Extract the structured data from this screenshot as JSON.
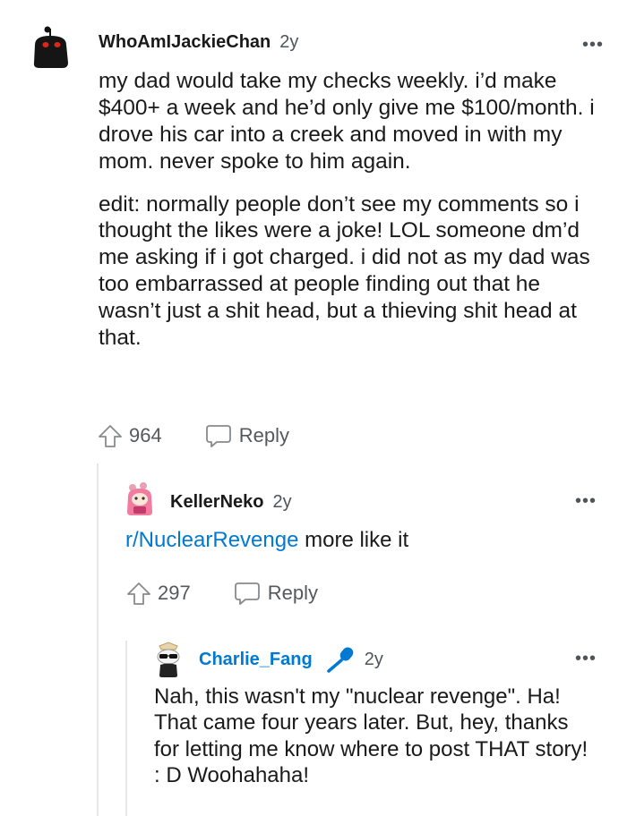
{
  "comments": [
    {
      "username": "WhoAmIJackieChan",
      "age": "2y",
      "paragraphs": [
        "my dad would take my checks weekly. i’d make $400+ a week and he’d only give me $100/month. i drove his car into a creek and moved in with my mom. never spoke to him again.",
        "edit: normally people don’t see my comments so i thought the likes were a joke! LOL someone dm’d me asking if i got charged. i did not as my dad was too embarrassed at people finding out that he wasn’t just a shit head, but a thieving shit head at that."
      ],
      "upvotes": "964",
      "reply_label": "Reply",
      "avatar_icon": "snoo-avatar-black-icon"
    },
    {
      "username": "KellerNeko",
      "age": "2y",
      "link_text": "r/NuclearRevenge",
      "text_after_link": " more like it",
      "upvotes": "297",
      "reply_label": "Reply",
      "avatar_icon": "snoo-avatar-pink-icon"
    },
    {
      "username": "Charlie_Fang",
      "age": "2y",
      "text": "Nah, this wasn't my \"nuclear revenge\". Ha! That came four years later. But, hey, thanks for letting me know where to post THAT story! : D Woohahaha!",
      "avatar_icon": "snoo-avatar-sunglasses-icon",
      "badge_icon": "microphone-icon"
    }
  ],
  "more_label": "•••",
  "colors": {
    "link": "#0079d3",
    "text": "#1a1a1b",
    "meta": "#4f5458",
    "thread_line": "#e5e7ea"
  }
}
